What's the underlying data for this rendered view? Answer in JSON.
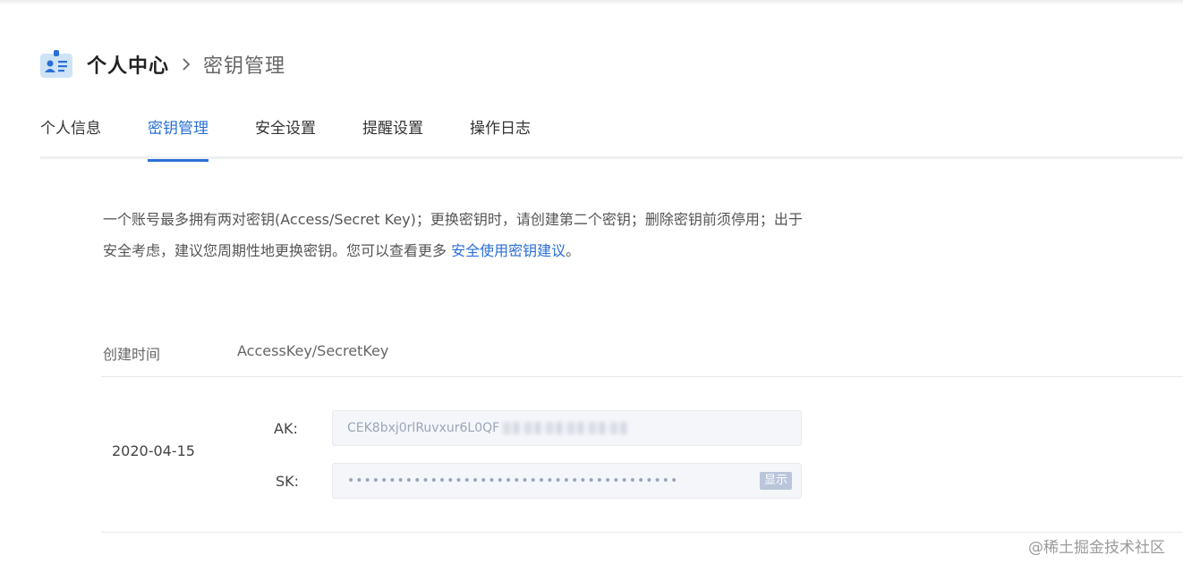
{
  "header": {
    "title": "个人中心",
    "subtitle": "密钥管理"
  },
  "tabs": [
    {
      "label": "个人信息",
      "active": false
    },
    {
      "label": "密钥管理",
      "active": true
    },
    {
      "label": "安全设置",
      "active": false
    },
    {
      "label": "提醒设置",
      "active": false
    },
    {
      "label": "操作日志",
      "active": false
    }
  ],
  "description": {
    "text": "一个账号最多拥有两对密钥(Access/Secret Key)；更换密钥时，请创建第二个密钥；删除密钥前须停用；出于安全考虑，建议您周期性地更换密钥。您可以查看更多 ",
    "link": "安全使用密钥建议",
    "suffix": "。"
  },
  "table": {
    "columns": [
      "创建时间",
      "AccessKey/SecretKey"
    ],
    "rows": [
      {
        "created": "2020-04-15",
        "ak_label": "AK:",
        "ak_value": "CEK8bxj0rlRuvxur6L0QF",
        "sk_label": "SK:",
        "sk_value": "••••••••••••••••••••••••••••••••••••••••",
        "show_label": "显示"
      }
    ]
  },
  "watermark": "@稀土掘金技术社区",
  "colors": {
    "accent": "#2a6fd6",
    "icon_bg": "#cfe3f7"
  }
}
